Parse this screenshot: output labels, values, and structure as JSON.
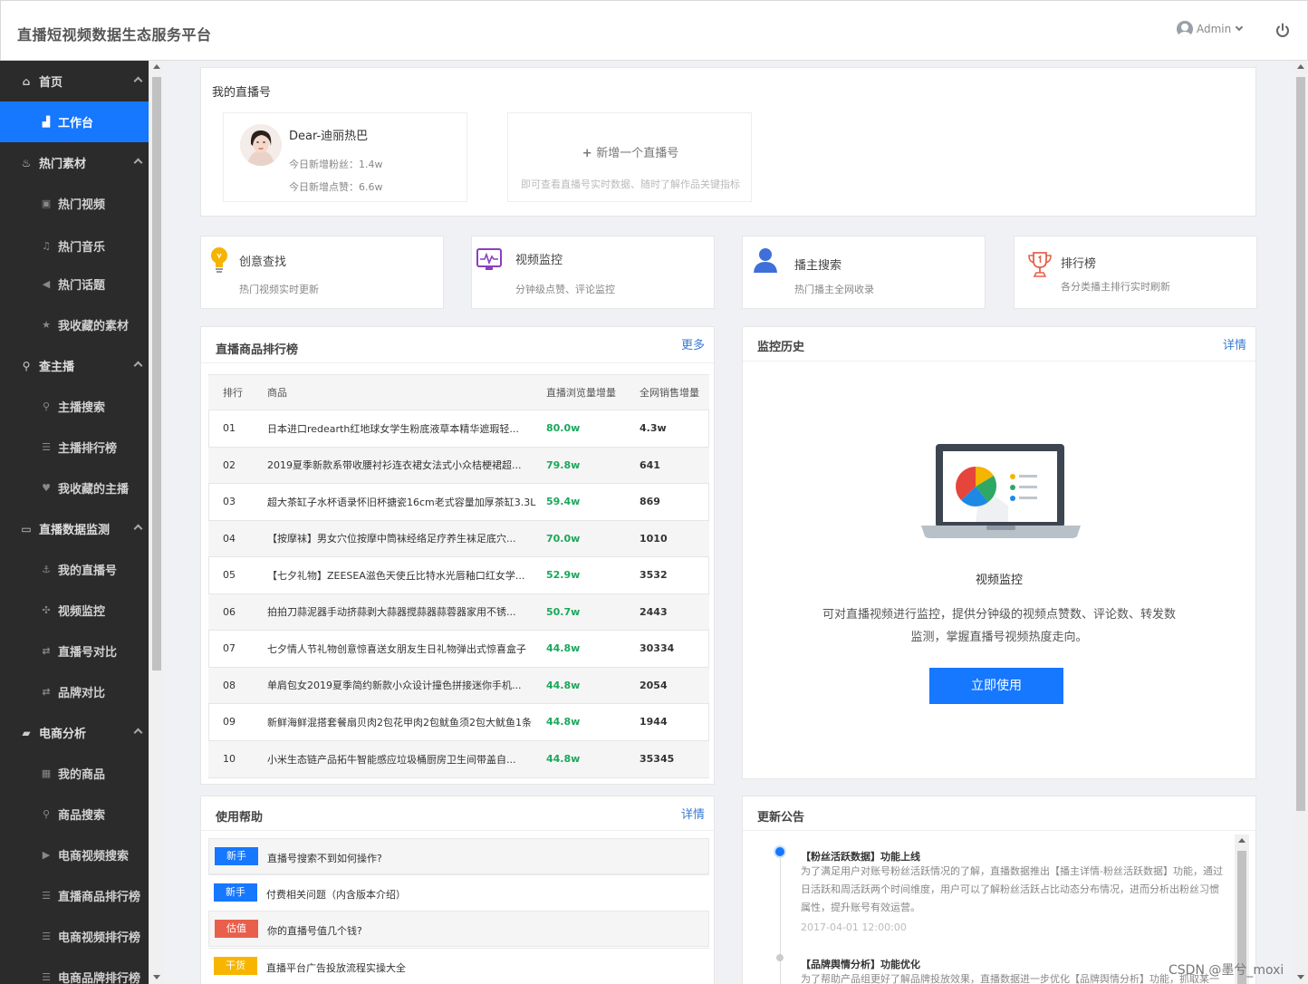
{
  "header": {
    "title": "直播短视频数据生态服务平台",
    "user": "Admin"
  },
  "sidebar": {
    "sections": [
      {
        "label": "首页",
        "icon": "home-icon"
      },
      {
        "label": "热门素材",
        "icon": "fire-icon"
      },
      {
        "label": "查主播",
        "icon": "search-icon"
      },
      {
        "label": "直播数据监测",
        "icon": "monitor-icon"
      },
      {
        "label": "电商分析",
        "icon": "bag-icon"
      }
    ],
    "items": [
      {
        "label": "工作台",
        "icon": "chart-icon",
        "active": true
      },
      {
        "label": "热门视频",
        "icon": "video-icon"
      },
      {
        "label": "热门音乐",
        "icon": "music-icon"
      },
      {
        "label": "热门话题",
        "icon": "megaphone-icon"
      },
      {
        "label": "我收藏的素材",
        "icon": "star-icon"
      },
      {
        "label": "主播搜索",
        "icon": "search-icon"
      },
      {
        "label": "主播排行榜",
        "icon": "list-icon"
      },
      {
        "label": "我收藏的主播",
        "icon": "heart-icon"
      },
      {
        "label": "我的直播号",
        "icon": "anchor-icon"
      },
      {
        "label": "视频监控",
        "icon": "crosshair-icon"
      },
      {
        "label": "直播号对比",
        "icon": "swap-icon"
      },
      {
        "label": "品牌对比",
        "icon": "swap-icon"
      },
      {
        "label": "我的商品",
        "icon": "grid-icon"
      },
      {
        "label": "商品搜索",
        "icon": "search-icon"
      },
      {
        "label": "电商视频搜索",
        "icon": "play-icon"
      },
      {
        "label": "直播商品排行榜",
        "icon": "list-icon"
      },
      {
        "label": "电商视频排行榜",
        "icon": "list-icon"
      },
      {
        "label": "电商品牌排行榜",
        "icon": "list-icon"
      }
    ]
  },
  "live": {
    "title": "我的直播号",
    "account": {
      "name": "Dear-迪丽热巴",
      "fans_line": "今日新增粉丝：1.4w",
      "likes_line": "今日新增点赞：6.6w"
    },
    "add": {
      "label": "新增一个直播号",
      "hint": "即可查看直播号实时数据、随时了解作品关键指标"
    }
  },
  "tiles": [
    {
      "title": "创意查找",
      "desc": "热门视频实时更新",
      "icon": "lightbulb-icon"
    },
    {
      "title": "视频监控",
      "desc": "分钟级点赞、评论监控",
      "icon": "pulse-monitor-icon"
    },
    {
      "title": "播主搜索",
      "desc": "热门播主全网收录",
      "icon": "user-icon"
    },
    {
      "title": "排行榜",
      "desc": "各分类播主排行实时刷新",
      "icon": "trophy-icon"
    }
  ],
  "rank": {
    "title": "直播商品排行榜",
    "more": "更多",
    "headers": [
      "排行",
      "商品",
      "直播浏览量增量",
      "全网销售增量"
    ],
    "rows": [
      [
        "01",
        "日本进口redearth红地球女学生粉底液草本精华遮瑕轻...",
        "80.0w",
        "4.3w"
      ],
      [
        "02",
        "2019夏季新款系带收腰衬衫连衣裙女法式小众桔梗裙超...",
        "79.8w",
        "641"
      ],
      [
        "03",
        "超大茶缸子水杯语录怀旧杯搪瓷16cm老式容量加厚茶缸3.3L",
        "59.4w",
        "869"
      ],
      [
        "04",
        "【按摩袜】男女穴位按摩中筒袜经络足疗养生袜足底穴...",
        "70.0w",
        "1010"
      ],
      [
        "05",
        "【七夕礼物】ZEESEA滋色天使丘比特水光唇釉口红女学...",
        "52.9w",
        "3532"
      ],
      [
        "06",
        "拍拍刀蒜泥器手动挤蒜剥大蒜器搅蒜器蒜蓉器家用不锈...",
        "50.7w",
        "2443"
      ],
      [
        "07",
        "七夕情人节礼物创意惊喜送女朋友生日礼物弹出式惊喜盒子",
        "44.8w",
        "30334"
      ],
      [
        "08",
        "单肩包女2019夏季简约新款小众设计撞色拼接迷你手机...",
        "44.8w",
        "2054"
      ],
      [
        "09",
        "新鲜海鲜混搭套餐扇贝肉2包花甲肉2包鱿鱼须2包大鱿鱼1条",
        "44.8w",
        "1944"
      ],
      [
        "10",
        "小米生态链产品拓牛智能感应垃圾桶厨房卫生间带盖自...",
        "44.8w",
        "35345"
      ]
    ]
  },
  "monitor": {
    "title": "监控历史",
    "more": "详情",
    "heading": "视频监控",
    "desc1": "可对直播视频进行监控，提供分钟级的视频点赞数、评论数、转发数",
    "desc2": "监测，掌握直播号视频热度走向。",
    "button": "立即使用"
  },
  "help": {
    "title": "使用帮助",
    "more": "详情",
    "rows": [
      {
        "tag": "新手",
        "color": "#1677ff",
        "text": "直播号搜索不到如何操作?"
      },
      {
        "tag": "新手",
        "color": "#1677ff",
        "text": "付费相关问题（内含版本介绍）"
      },
      {
        "tag": "估值",
        "color": "#e8604c",
        "text": "你的直播号值几个钱?"
      },
      {
        "tag": "干货",
        "color": "#f7b500",
        "text": "直播平台广告投放流程实操大全"
      }
    ]
  },
  "notice": {
    "title": "更新公告",
    "items": [
      {
        "title": "【粉丝活跃数据】功能上线",
        "text": "为了满足用户对账号粉丝活跃情况的了解，直播数据推出【播主详情-粉丝活跃数据】功能，通过日活跃和周活跃两个时间维度，用户可以了解粉丝活跃占比动态分布情况，进而分析出粉丝习惯属性，提升账号有效运营。",
        "time": "2017-04-01 12:00:00"
      },
      {
        "title": "【品牌舆情分析】功能优化",
        "text": "为了帮助产品组更好了解品牌投放效果，直播数据进一步优化【品牌舆情分析】功能，抓取某一品",
        "time": ""
      }
    ]
  },
  "watermark": "CSDN @墨兮_moxi"
}
